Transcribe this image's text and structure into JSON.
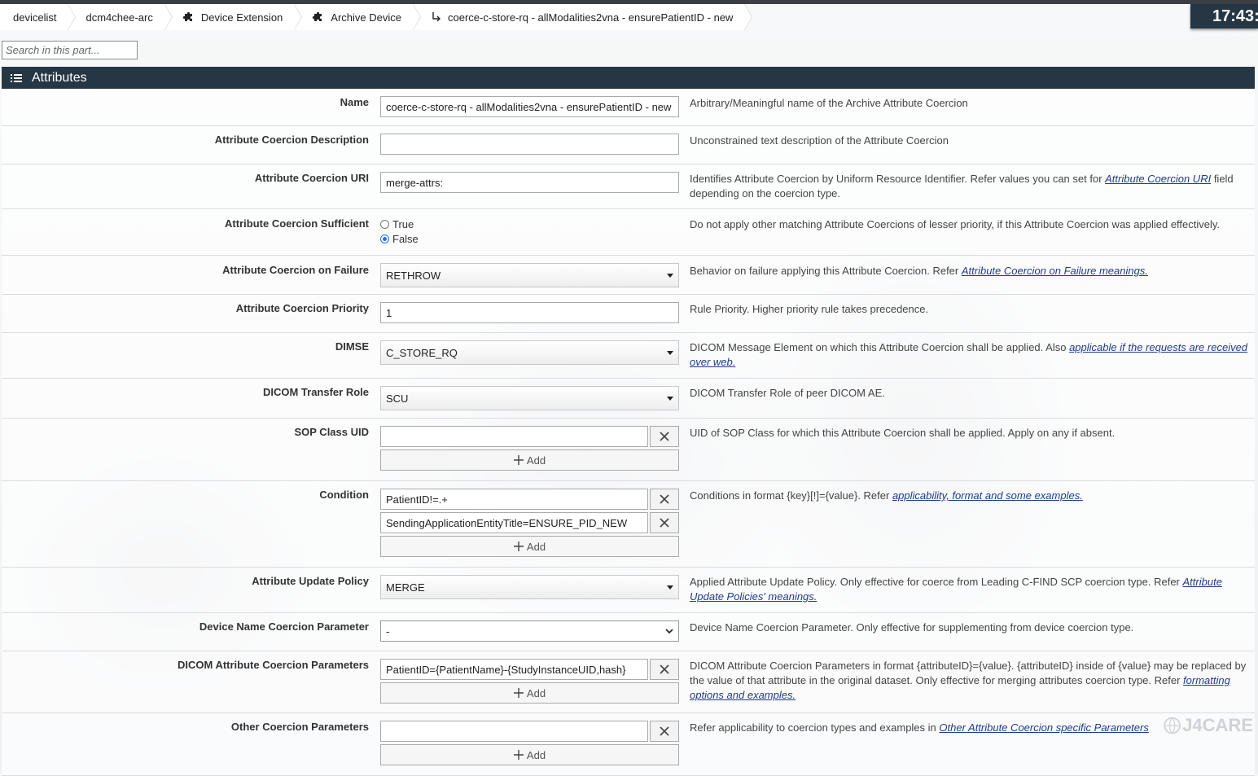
{
  "breadcrumb": [
    {
      "label": "devicelist",
      "icon": ""
    },
    {
      "label": "dcm4chee-arc",
      "icon": ""
    },
    {
      "label": "Device Extension",
      "icon": "puzzle-icon"
    },
    {
      "label": "Archive Device",
      "icon": "puzzle-icon"
    },
    {
      "label": "coerce-c-store-rq - allModalities2vna - ensurePatientID - new",
      "icon": "child-arrow-icon"
    }
  ],
  "clock": "17:43:",
  "search": {
    "placeholder": "Search in this part..."
  },
  "panel": {
    "title": "Attributes",
    "icon": "list-icon"
  },
  "fields": {
    "name": {
      "label": "Name",
      "value": "coerce-c-store-rq - allModalities2vna - ensurePatientID - new",
      "desc": "Arbitrary/Meaningful name of the Archive Attribute Coercion"
    },
    "description": {
      "label": "Attribute Coercion Description",
      "value": "",
      "desc": "Unconstrained text description of the Attribute Coercion"
    },
    "uri": {
      "label": "Attribute Coercion URI",
      "value": "merge-attrs:",
      "desc_pre": "Identifies Attribute Coercion by Uniform Resource Identifier. Refer values you can set for ",
      "desc_link": "Attribute Coercion URI",
      "desc_post": " field depending on the coercion type."
    },
    "sufficient": {
      "label": "Attribute Coercion Sufficient",
      "options": [
        "True",
        "False"
      ],
      "selected": "False",
      "desc": "Do not apply other matching Attribute Coercions of lesser priority, if this Attribute Coercion was applied effectively."
    },
    "on_failure": {
      "label": "Attribute Coercion on Failure",
      "value": "RETHROW",
      "desc_pre": "Behavior on failure applying this Attribute Coercion. Refer ",
      "desc_link": "Attribute Coercion on Failure meanings."
    },
    "priority": {
      "label": "Attribute Coercion Priority",
      "value": "1",
      "desc": "Rule Priority. Higher priority rule takes precedence."
    },
    "dimse": {
      "label": "DIMSE",
      "value": "C_STORE_RQ",
      "desc_pre": "DICOM Message Element on which this Attribute Coercion shall be applied. Also ",
      "desc_link": "applicable if the requests are received over web."
    },
    "transfer_role": {
      "label": "DICOM Transfer Role",
      "value": "SCU",
      "desc": "DICOM Transfer Role of peer DICOM AE."
    },
    "sop_class": {
      "label": "SOP Class UID",
      "values": [
        ""
      ],
      "add_label": "Add",
      "desc": "UID of SOP Class for which this Attribute Coercion shall be applied. Apply on any if absent."
    },
    "condition": {
      "label": "Condition",
      "values": [
        "PatientID!=.+",
        "SendingApplicationEntityTitle=ENSURE_PID_NEW"
      ],
      "add_label": "Add",
      "desc_pre": "Conditions in format {key}[!]={value}. Refer ",
      "desc_link": "applicability, format and some examples."
    },
    "update_policy": {
      "label": "Attribute Update Policy",
      "value": "MERGE",
      "desc_pre": "Applied Attribute Update Policy. Only effective for coerce from Leading C-FIND SCP coercion type. Refer ",
      "desc_link": "Attribute Update Policies' meanings."
    },
    "device_name_param": {
      "label": "Device Name Coercion Parameter",
      "value": "-",
      "desc": "Device Name Coercion Parameter. Only effective for supplementing from device coercion type."
    },
    "dicom_params": {
      "label": "DICOM Attribute Coercion Parameters",
      "values": [
        "PatientID={PatientName}-{StudyInstanceUID,hash}"
      ],
      "add_label": "Add",
      "desc_pre": "DICOM Attribute Coercion Parameters in format {attributeID}={value}. {attributeID} inside of {value} may be replaced by the value of that attribute in the original dataset. Only effective for merging attributes coercion type. Refer ",
      "desc_link": "formatting options and examples."
    },
    "other_params": {
      "label": "Other Coercion Parameters",
      "values": [
        ""
      ],
      "add_label": "Add",
      "desc_pre": "Refer applicability to coercion types and examples in ",
      "desc_link": "Other Attribute Coercion specific Parameters"
    }
  },
  "watermark": "J4CARE"
}
